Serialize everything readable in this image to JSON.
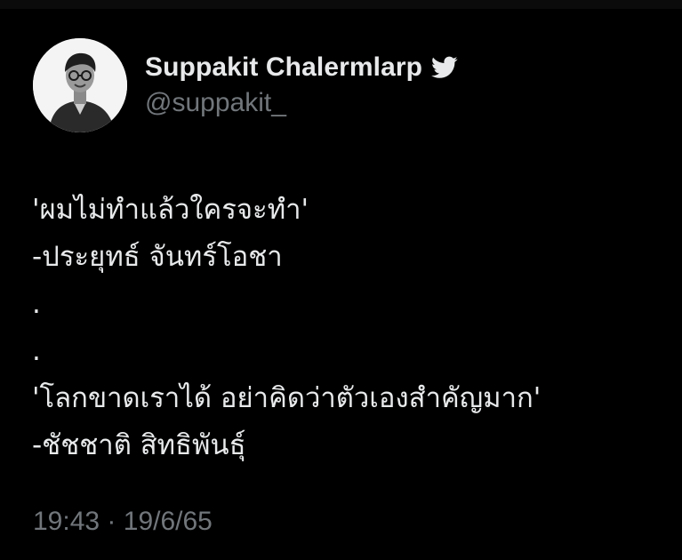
{
  "author": {
    "display_name": "Suppakit Chalermlarp",
    "handle": "@suppakit_",
    "avatar_icon": "profile-photo-grayscale",
    "badge_icon": "twitter-bird-icon"
  },
  "tweet": {
    "lines": [
      "'ผมไม่ทำแล้วใครจะทำ'",
      "-ประยุทธ์ จันทร์โอชา",
      ".",
      ".",
      "'โลกขาดเราได้ อย่าคิดว่าตัวเองสำคัญมาก'",
      "-ชัชชาติ สิทธิพันธุ์"
    ]
  },
  "meta": {
    "time": "19:43",
    "separator": "·",
    "date": "19/6/65"
  },
  "colors": {
    "background": "#000000",
    "text": "#e7e9ea",
    "secondary_text": "#71767b"
  }
}
